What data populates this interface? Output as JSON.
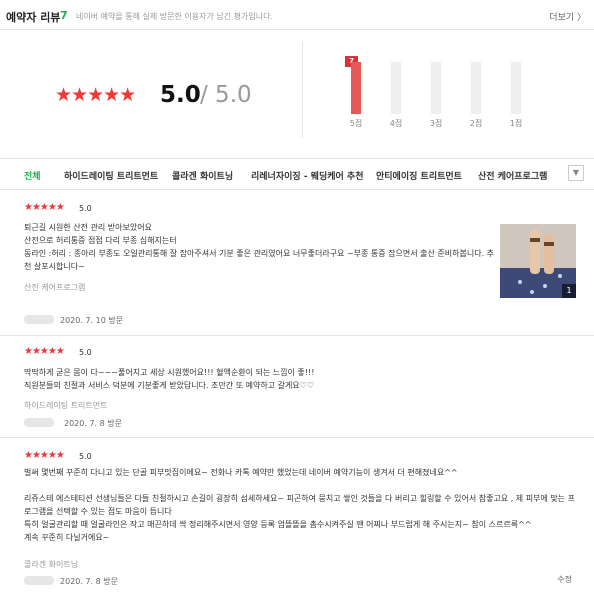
{
  "header": {
    "title": "예약자 리뷰",
    "count": "7",
    "description": "네이버 예약을 통해 실제 방문한 이용자가 남긴 평가입니다.",
    "more_label": "더보기 〉"
  },
  "rating": {
    "stars": "★★★★★",
    "score": "5.0",
    "out_of": "/ 5.0"
  },
  "distribution": {
    "accent_color": "#e8595a",
    "bars": [
      {
        "label": "5점",
        "count": "7",
        "fraction": 1.0
      },
      {
        "label": "4점",
        "count": "",
        "fraction": 0
      },
      {
        "label": "3점",
        "count": "",
        "fraction": 0
      },
      {
        "label": "2점",
        "count": "",
        "fraction": 0
      },
      {
        "label": "1점",
        "count": "",
        "fraction": 0
      }
    ]
  },
  "tabs": {
    "items": [
      "전체",
      "하이드레이팅 트리트먼트",
      "콜라겐 화이트닝",
      "리레너자이징 - 웨딩케어 추천",
      "안티에이징 트리트먼트",
      "산전 케어프로그램"
    ],
    "active": "전체",
    "more_icon": "chevron-down-icon"
  },
  "reviews": [
    {
      "stars": "★★★★★",
      "score": "5.0",
      "lines": [
        "퇴근길 시원한 산전 관리 받아보았어요",
        "산전으로 허리통증 점점 다리 부종 심해지는터",
        "동라인 :허리 : 종아리 부종도 오일관리통해 잘 잡아주셔서 기분 좋은 관리였어요 너무좋더라구요 ~부종 통증 잡으면서 출산 준비하봅니다. 추",
        "천 살포시합니다~"
      ],
      "tag": "산전 케어프로그램",
      "date": "2020. 7. 10 방문",
      "photo_count": "1"
    },
    {
      "stars": "★★★★★",
      "score": "5.0",
      "lines": [
        "딱딱하게 굳은 몸이 다~~~풀어지고 세상 시원했어요!!! 혈액순환이 되는 느낌이 좋!!!",
        "직원분들의 친절과 서비스 덕분에 기분좋게 받았답니다. 조만간 또 예약하고 갈게요♡♡"
      ],
      "tag": "하이드레이팅 트리트먼트",
      "date": "2020. 7. 8 방문"
    },
    {
      "stars": "★★★★★",
      "score": "5.0",
      "lines": [
        "벌써 몇번째 꾸준히 다니고 있는 단골 피부맛집이에요~ 전화나 카톡 예약만 했었는데 네이버 예약기능이 생겨서 더 편해졌네요^^",
        "",
        "리쥬스테 에스테티션 선생님들은 다들 친절하시고 손길이 굉장히 섬세하세요~ 피곤하여 뭉치고 쌓인 것들을 다 버리고 힐링할 수 있어서 참좋고요 , 제 피부에 맞는 프",
        "로그램을 선택할 수 있는 점도 마음이 듭니다",
        "특히 얼굴관리할 때 얼굴라인은 작고 매끈하데 싹 정리해주시면서 영양 등록 엄뜰뜰을 촘수시켜주실 땐 어찌나 부드럽게 해 주시는지~ 참이 스르르륵^^",
        "계속 꾸준히 다닐거에요~"
      ],
      "tag": "콜라겐 화이트닝",
      "date": "2020. 7. 8 방문",
      "edit_label": "수정"
    }
  ]
}
